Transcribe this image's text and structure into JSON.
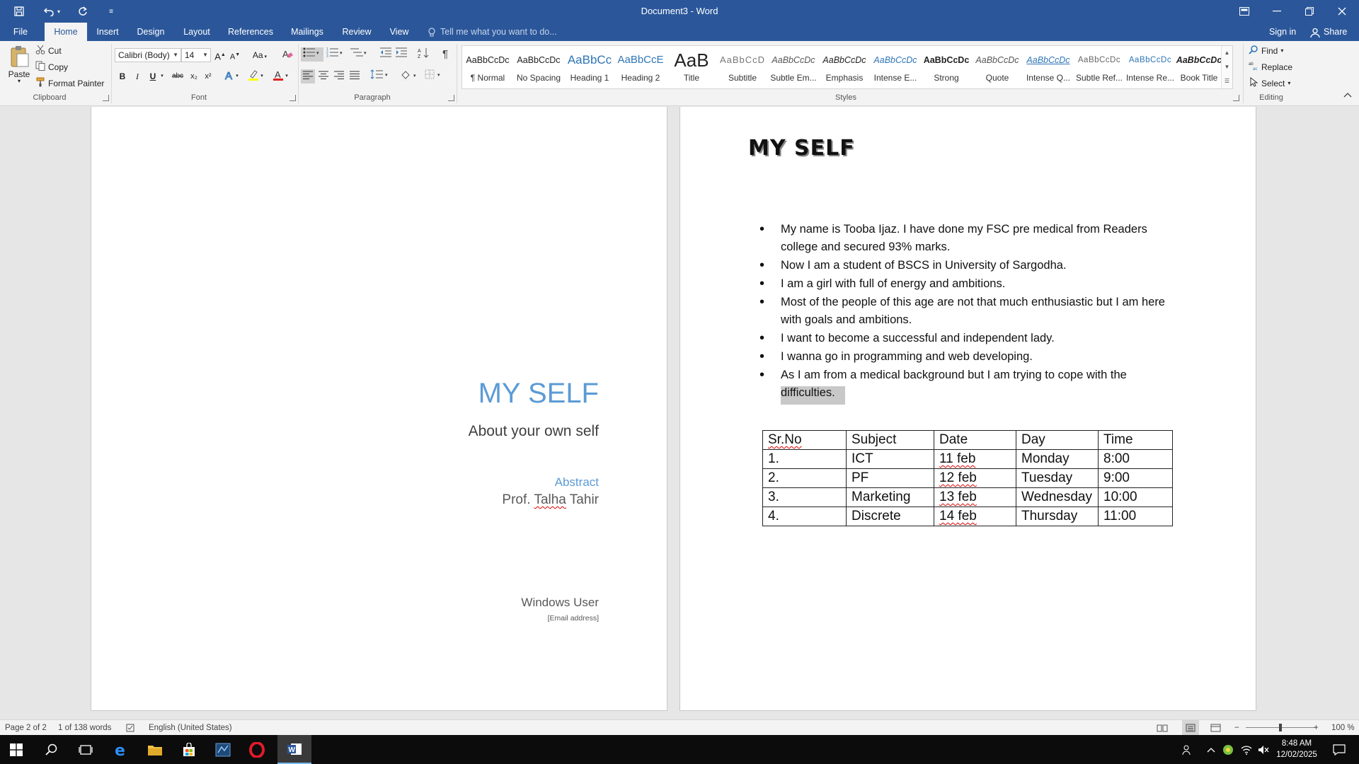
{
  "window": {
    "title": "Document3 - Word",
    "quick_access": [
      "save-icon",
      "undo-icon",
      "redo-icon",
      "customize-icon"
    ]
  },
  "tabs": [
    {
      "label": "File"
    },
    {
      "label": "Home",
      "active": true
    },
    {
      "label": "Insert"
    },
    {
      "label": "Design"
    },
    {
      "label": "Layout"
    },
    {
      "label": "References"
    },
    {
      "label": "Mailings"
    },
    {
      "label": "Review"
    },
    {
      "label": "View"
    }
  ],
  "tell_me": {
    "placeholder": "Tell me what you want to do..."
  },
  "account": {
    "sign_in": "Sign in",
    "share": "Share"
  },
  "ribbon": {
    "clipboard": {
      "paste": "Paste",
      "cut": "Cut",
      "copy": "Copy",
      "format_painter": "Format Painter",
      "label": "Clipboard"
    },
    "font": {
      "name": "Calibri (Body)",
      "size": "14",
      "change_case": "Aa",
      "bold": "B",
      "italic": "I",
      "underline": "U",
      "strike": "abc",
      "subscript": "x₂",
      "superscript": "x²",
      "label": "Font"
    },
    "paragraph": {
      "label": "Paragraph"
    },
    "styles": {
      "label": "Styles",
      "items": [
        {
          "sample": "AaBbCcDc",
          "name": "¶ Normal"
        },
        {
          "sample": "AaBbCcDc",
          "name": "No Spacing"
        },
        {
          "sample": "AaBbCc",
          "name": "Heading 1"
        },
        {
          "sample": "AaBbCcE",
          "name": "Heading 2"
        },
        {
          "sample": "AaB",
          "name": "Title"
        },
        {
          "sample": "AaBbCcD",
          "name": "Subtitle"
        },
        {
          "sample": "AaBbCcDc",
          "name": "Subtle Em..."
        },
        {
          "sample": "AaBbCcDc",
          "name": "Emphasis"
        },
        {
          "sample": "AaBbCcDc",
          "name": "Intense E..."
        },
        {
          "sample": "AaBbCcDc",
          "name": "Strong"
        },
        {
          "sample": "AaBbCcDc",
          "name": "Quote"
        },
        {
          "sample": "AaBbCcDc",
          "name": "Intense Q..."
        },
        {
          "sample": "AaBbCcDc",
          "name": "Subtle Ref..."
        },
        {
          "sample": "AaBbCcDc",
          "name": "Intense Re..."
        },
        {
          "sample": "AaBbCcDc",
          "name": "Book Title"
        }
      ]
    },
    "editing": {
      "find": "Find",
      "replace": "Replace",
      "select": "Select",
      "label": "Editing"
    }
  },
  "page1": {
    "title": "MY SELF",
    "subtitle": "About your own self",
    "abstract": "Abstract",
    "prof_prefix": "Prof. ",
    "prof_name_misspelled": "Talha",
    "prof_suffix": " Tahir",
    "author": "Windows User",
    "email": "[Email address]"
  },
  "page2": {
    "heading": "MY SELF",
    "bullets": [
      "My name is Tooba Ijaz. I have done my FSC pre medical from Readers college and secured 93% marks.",
      "Now I am a student of BSCS in University of Sargodha.",
      "I am a girl with full of energy and ambitions.",
      "Most of the people of this age are not that much enthusiastic but I am here with goals and ambitions.",
      "I want to become a successful and independent lady.",
      "I wanna go in programming and web developing.",
      "As I am from a medical background but I am trying to cope with the"
    ],
    "bullet_last_selected": "difficulties.",
    "table": {
      "headers": [
        "Sr.No",
        "Subject",
        "Date",
        "Day",
        "Time"
      ],
      "rows": [
        [
          "1.",
          "ICT",
          "11 feb",
          "Monday",
          "8:00"
        ],
        [
          "2.",
          "PF",
          "12 feb",
          "Tuesday",
          "9:00"
        ],
        [
          "3.",
          "Marketing",
          "13 feb",
          "Wednesday",
          "10:00"
        ],
        [
          "4.",
          "Discrete",
          "14 feb",
          "Thursday",
          "11:00"
        ]
      ]
    }
  },
  "status": {
    "page": "Page 2 of 2",
    "words": "1 of 138 words",
    "language": "English (United States)",
    "zoom": "100 %"
  },
  "taskbar": {
    "time": "8:48 AM",
    "date": "12/02/2025"
  },
  "colors": {
    "brand": "#2b579a",
    "accent_blue": "#5b9bd5"
  }
}
